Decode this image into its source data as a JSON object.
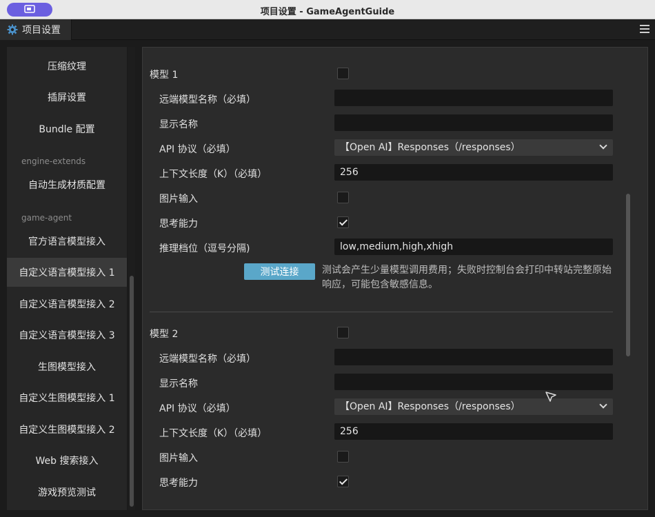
{
  "window": {
    "title": "项目设置 - GameAgentGuide"
  },
  "tab": {
    "label": "项目设置"
  },
  "sidebar": {
    "items": [
      {
        "label": "压缩纹理"
      },
      {
        "label": "插屏设置"
      },
      {
        "label": "Bundle 配置"
      },
      {
        "label": "engine-extends"
      },
      {
        "label": "自动生成材质配置"
      },
      {
        "label": "game-agent"
      },
      {
        "label": "官方语言模型接入"
      },
      {
        "label": "自定义语言模型接入 1"
      },
      {
        "label": "自定义语言模型接入 2"
      },
      {
        "label": "自定义语言模型接入 3"
      },
      {
        "label": "生图模型接入"
      },
      {
        "label": "自定义生图模型接入 1"
      },
      {
        "label": "自定义生图模型接入 2"
      },
      {
        "label": "Web 搜索接入"
      },
      {
        "label": "游戏预览测试"
      }
    ]
  },
  "model1": {
    "title": "模型 1",
    "remote_name_label": "远端模型名称（必填）",
    "remote_name_value": "",
    "display_name_label": "显示名称",
    "display_name_value": "",
    "api_label": "API 协议（必填）",
    "api_value": "【Open AI】Responses（/responses）",
    "context_label": "上下文长度（K）（必填）",
    "context_value": "256",
    "image_input_label": "图片输入",
    "image_input_checked": false,
    "reasoning_label": "思考能力",
    "reasoning_checked": true,
    "reasoning_levels_label": "推理档位（逗号分隔)",
    "reasoning_levels_value": "low,medium,high,xhigh",
    "test_button": "测试连接",
    "test_note": "测试会产生少量模型调用费用；失败时控制台会打印中转站完整原始响应，可能包含敏感信息。"
  },
  "model2": {
    "title": "模型 2",
    "remote_name_label": "远端模型名称（必填）",
    "remote_name_value": "",
    "display_name_label": "显示名称",
    "display_name_value": "",
    "api_label": "API 协议（必填）",
    "api_value": "【Open AI】Responses（/responses）",
    "context_label": "上下文长度（K）（必填）",
    "context_value": "256",
    "image_input_label": "图片输入",
    "image_input_checked": false,
    "reasoning_label": "思考能力",
    "reasoning_checked": true
  },
  "colors": {
    "accent_button": "#5aa7c9",
    "window_button": "#6b5fe0"
  }
}
